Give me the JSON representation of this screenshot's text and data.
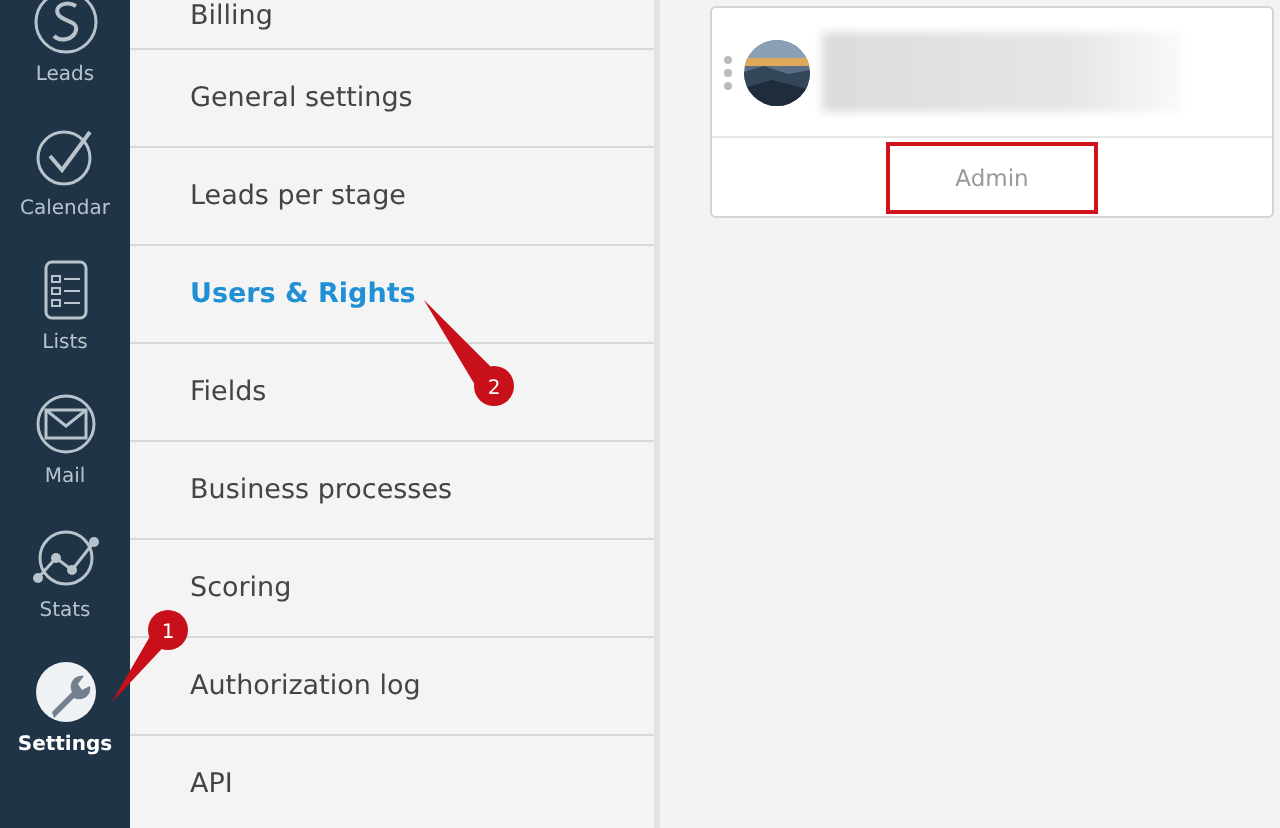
{
  "nav": [
    {
      "label": "Leads",
      "kind": "leads",
      "selected": false
    },
    {
      "label": "Calendar",
      "kind": "calendar",
      "selected": false
    },
    {
      "label": "Lists",
      "kind": "lists",
      "selected": false
    },
    {
      "label": "Mail",
      "kind": "mail",
      "selected": false
    },
    {
      "label": "Stats",
      "kind": "stats",
      "selected": false
    },
    {
      "label": "Settings",
      "kind": "settings",
      "selected": true
    }
  ],
  "settings_menu": [
    {
      "label": "Billing",
      "selected": false
    },
    {
      "label": "General settings",
      "selected": false
    },
    {
      "label": "Leads per stage",
      "selected": false
    },
    {
      "label": "Users & Rights",
      "selected": true
    },
    {
      "label": "Fields",
      "selected": false
    },
    {
      "label": "Business processes",
      "selected": false
    },
    {
      "label": "Scoring",
      "selected": false
    },
    {
      "label": "Authorization log",
      "selected": false
    },
    {
      "label": "API",
      "selected": false
    }
  ],
  "user_card": {
    "role": "Admin",
    "highlighted": true
  },
  "callouts": [
    {
      "number": "1",
      "kind": "nav"
    },
    {
      "number": "2",
      "kind": "menu"
    }
  ]
}
